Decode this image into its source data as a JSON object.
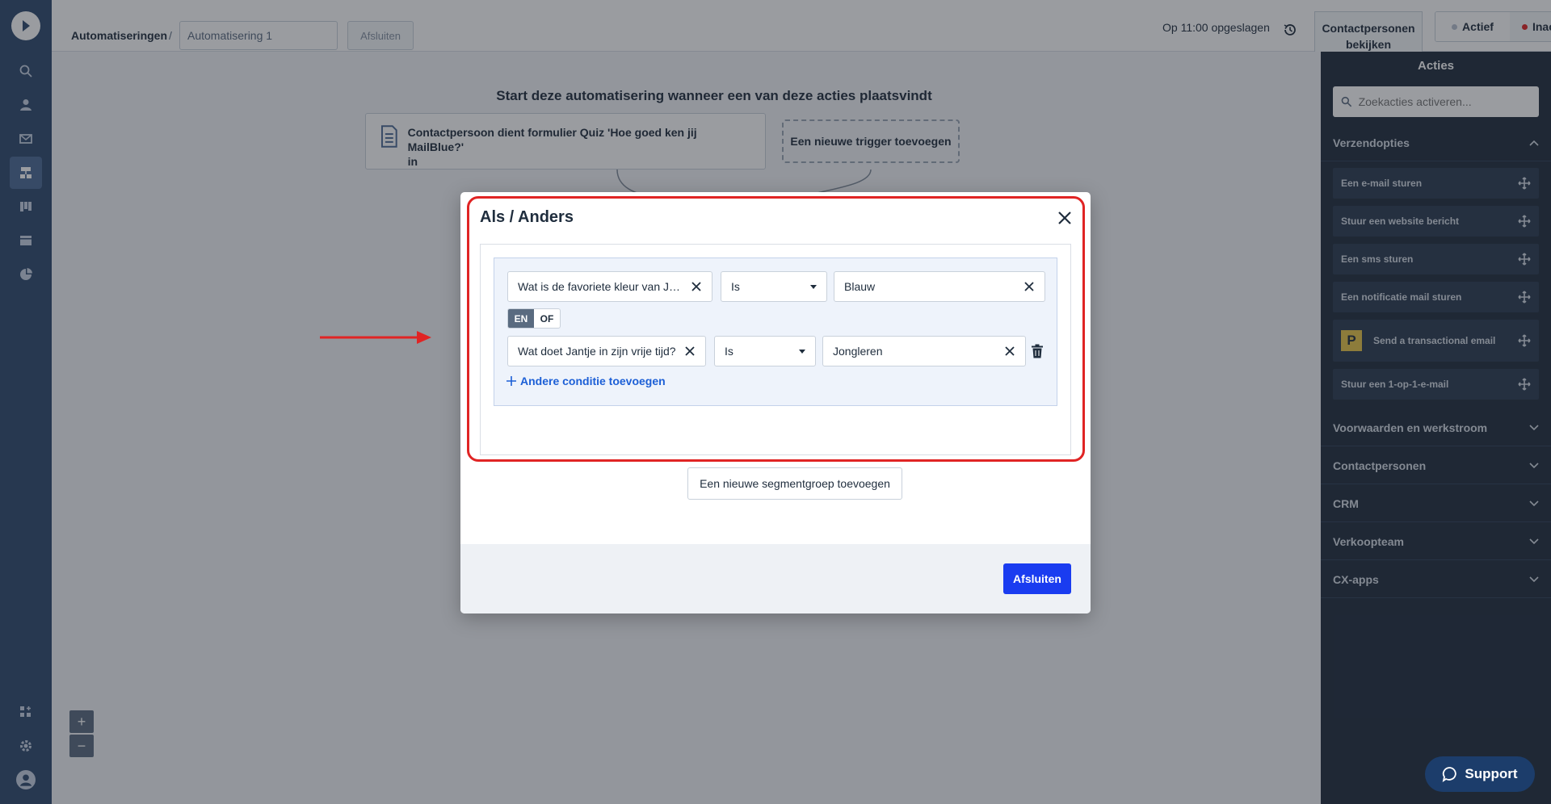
{
  "topbar": {
    "breadcrumb": "Automatiseringen",
    "breadcrumb_sep": "/",
    "automation_name": "Automatisering 1",
    "close_label": "Afsluiten",
    "saved_text": "Op 11:00 opgeslagen",
    "contacts_line1": "Contactpersonen",
    "contacts_line2": "bekijken",
    "status_active": "Actief",
    "status_inactive": "Inactief"
  },
  "canvas": {
    "trigger_title": "Start deze automatisering wanneer een van deze acties plaatsvindt",
    "trigger_text_line1": "Contactpersoon dient formulier Quiz 'Hoe goed ken jij MailBlue?'",
    "trigger_text_line2": "in",
    "new_trigger": "Een nieuwe trigger toevoegen",
    "zoom_in": "+",
    "zoom_out": "−"
  },
  "right_panel": {
    "title": "Acties",
    "search_placeholder": "Zoekacties activeren...",
    "sections": [
      "Verzendopties",
      "Voorwaarden en werkstroom",
      "Contactpersonen",
      "CRM",
      "Verkoopteam",
      "CX-apps"
    ],
    "items": [
      "Een e-mail sturen",
      "Stuur een website bericht",
      "Een sms sturen",
      "Een notificatie mail sturen",
      "Send a transactional email",
      "Stuur een 1-op-1-e-mail"
    ],
    "postmark_badge": "P"
  },
  "modal": {
    "title": "Als / Anders",
    "conditions": [
      {
        "field": "Wat is de favoriete kleur van Jant...",
        "operator": "Is",
        "value": "Blauw"
      },
      {
        "field": "Wat doet Jantje in zijn vrije tijd?",
        "operator": "Is",
        "value": "Jongleren"
      }
    ],
    "toggle_and": "EN",
    "toggle_or": "OF",
    "add_condition": "Andere conditie toevoegen",
    "add_segment_group": "Een nieuwe segmentgroep toevoegen",
    "close_button": "Afsluiten"
  },
  "support": "Support",
  "colors": {
    "sidebar": "#2f4a6e",
    "primary": "#1a3cf0",
    "highlight": "#e02424",
    "panel": "#1f2d3d"
  }
}
